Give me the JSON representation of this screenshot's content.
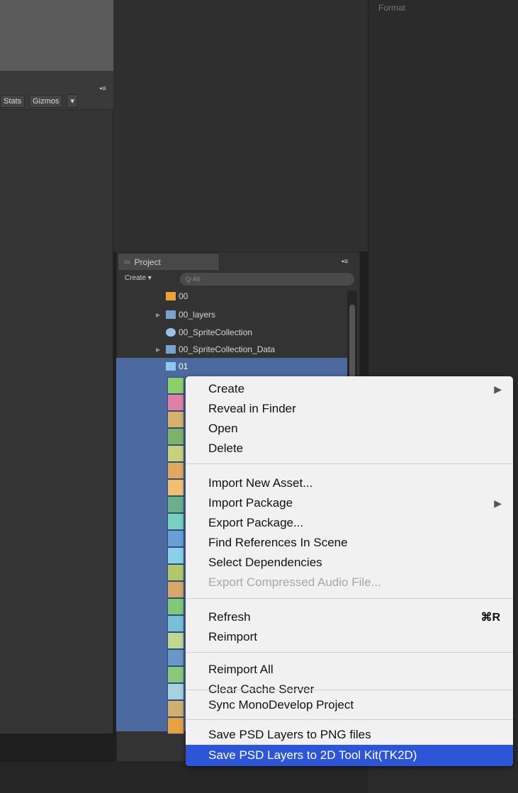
{
  "scene_view": {
    "toolbar": [
      "Stats",
      "Gizmos"
    ],
    "dropdown_glyph": "▾"
  },
  "format_panel": {
    "title": "Format"
  },
  "project": {
    "tab_label": "Project",
    "create_label": "Create",
    "search_placeholder": "Q-All",
    "items": [
      {
        "label": "00",
        "icon": "image-icon",
        "expandable": false
      },
      {
        "label": "00_layers",
        "icon": "folder-icon",
        "expandable": true
      },
      {
        "label": "00_SpriteCollection",
        "icon": "prefab-icon",
        "expandable": false
      },
      {
        "label": "00_SpriteCollection_Data",
        "icon": "folder-icon",
        "expandable": true
      },
      {
        "label": "01",
        "icon": "image-icon",
        "expandable": false,
        "selected": true
      }
    ]
  },
  "context_menu": {
    "items": [
      {
        "label": "Create",
        "submenu": true
      },
      {
        "label": "Reveal in Finder"
      },
      {
        "label": "Open"
      },
      {
        "label": "Delete"
      },
      {
        "label": "Import New Asset..."
      },
      {
        "label": "Import Package",
        "submenu": true
      },
      {
        "label": "Export Package..."
      },
      {
        "label": "Find References In Scene"
      },
      {
        "label": "Select Dependencies"
      },
      {
        "label": "Export Compressed Audio File...",
        "disabled": true
      },
      {
        "label": "Refresh",
        "shortcut": "⌘R"
      },
      {
        "label": "Reimport"
      },
      {
        "label": "Reimport All"
      },
      {
        "label": "Clear Cache Server"
      },
      {
        "label": "Sync MonoDevelop Project"
      },
      {
        "label": "Save PSD Layers to PNG files"
      },
      {
        "label": "Save PSD Layers to 2D Tool Kit(TK2D)",
        "highlighted": true
      }
    ]
  },
  "colors": {
    "selection": "#4c6aa0",
    "menu_highlight": "#2c55d8",
    "menu_bg": "#f1f1f1"
  }
}
